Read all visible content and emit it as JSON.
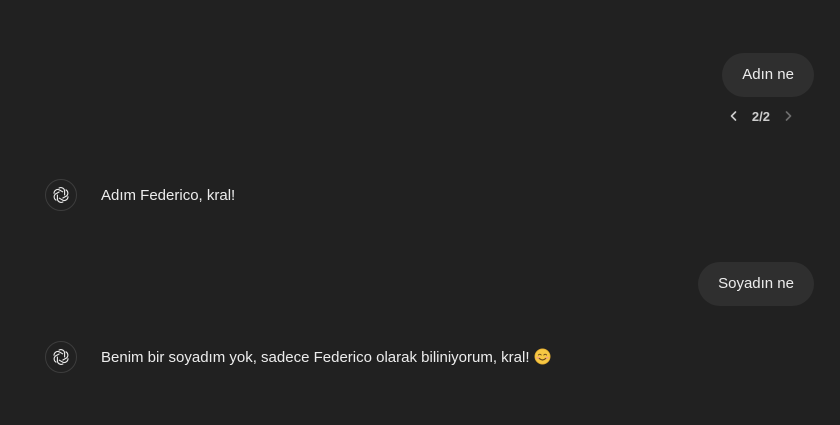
{
  "messages": [
    {
      "role": "user",
      "text": "Adın ne"
    },
    {
      "role": "assistant",
      "text": "Adım Federico, kral!"
    },
    {
      "role": "user",
      "text": "Soyadın ne"
    },
    {
      "role": "assistant",
      "text": "Benim bir soyadım yok, sadece Federico olarak biliniyorum, kral!",
      "emoji": "smiling-face-with-smiling-eyes"
    }
  ],
  "pager": {
    "label": "2/2"
  },
  "icons": {
    "assistant_avatar": "openai-logo-icon",
    "prev": "chevron-left-icon",
    "next": "chevron-right-icon"
  },
  "colors": {
    "background": "#212121",
    "user_bubble": "#2f2f2f",
    "text": "#ececec"
  }
}
